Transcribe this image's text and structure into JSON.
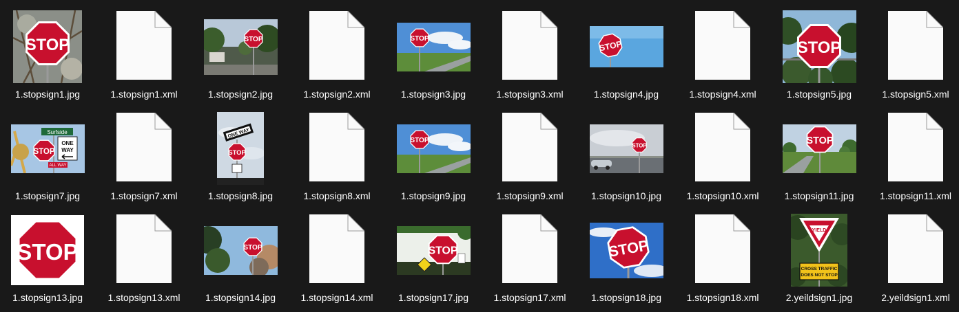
{
  "files": [
    {
      "name": "1.stopsign1.jpg",
      "kind": "image",
      "scene": "stop-branches"
    },
    {
      "name": "1.stopsign1.xml",
      "kind": "document"
    },
    {
      "name": "1.stopsign2.jpg",
      "kind": "image",
      "scene": "stop-street-small"
    },
    {
      "name": "1.stopsign2.xml",
      "kind": "document"
    },
    {
      "name": "1.stopsign3.jpg",
      "kind": "image",
      "scene": "stop-road-sky"
    },
    {
      "name": "1.stopsign3.xml",
      "kind": "document"
    },
    {
      "name": "1.stopsign4.jpg",
      "kind": "image",
      "scene": "stop-blue-sky"
    },
    {
      "name": "1.stopsign4.xml",
      "kind": "document"
    },
    {
      "name": "1.stopsign5.jpg",
      "kind": "image",
      "scene": "stop-trees-big"
    },
    {
      "name": "1.stopsign5.xml",
      "kind": "document"
    },
    {
      "name": "1.stopsign7.jpg",
      "kind": "image",
      "scene": "stop-oneway-streetsign"
    },
    {
      "name": "1.stopsign7.xml",
      "kind": "document"
    },
    {
      "name": "1.stopsign8.jpg",
      "kind": "image",
      "scene": "stop-oneway-portrait"
    },
    {
      "name": "1.stopsign8.xml",
      "kind": "document"
    },
    {
      "name": "1.stopsign9.jpg",
      "kind": "image",
      "scene": "stop-road-sky"
    },
    {
      "name": "1.stopsign9.xml",
      "kind": "document"
    },
    {
      "name": "1.stopsign10.jpg",
      "kind": "image",
      "scene": "stop-car-road"
    },
    {
      "name": "1.stopsign10.xml",
      "kind": "document"
    },
    {
      "name": "1.stopsign11.jpg",
      "kind": "image",
      "scene": "stop-field"
    },
    {
      "name": "1.stopsign11.xml",
      "kind": "document"
    },
    {
      "name": "1.stopsign13.jpg",
      "kind": "image",
      "scene": "stop-white"
    },
    {
      "name": "1.stopsign13.xml",
      "kind": "document"
    },
    {
      "name": "1.stopsign14.jpg",
      "kind": "image",
      "scene": "stop-autumn-trees"
    },
    {
      "name": "1.stopsign14.xml",
      "kind": "document"
    },
    {
      "name": "1.stopsign17.jpg",
      "kind": "image",
      "scene": "stop-pedestrian"
    },
    {
      "name": "1.stopsign17.xml",
      "kind": "document"
    },
    {
      "name": "1.stopsign18.jpg",
      "kind": "image",
      "scene": "stop-deep-blue"
    },
    {
      "name": "1.stopsign18.xml",
      "kind": "document"
    },
    {
      "name": "2.yeildsign1.jpg",
      "kind": "image",
      "scene": "yield-cross-traffic"
    },
    {
      "name": "2.yeildsign1.xml",
      "kind": "document"
    }
  ],
  "sign_text": {
    "stop": "STOP",
    "one_way": "ONE WAY",
    "yield": "YIELD",
    "street": "Surfside",
    "all_way": "ALL WAY",
    "cross_traffic_1": "CROSS TRAFFIC",
    "cross_traffic_2": "DOES NOT STOP"
  },
  "colors": {
    "background": "#191919",
    "label": "#ffffff",
    "doc_page": "#fafafa",
    "sign_red": "#c8102e"
  }
}
